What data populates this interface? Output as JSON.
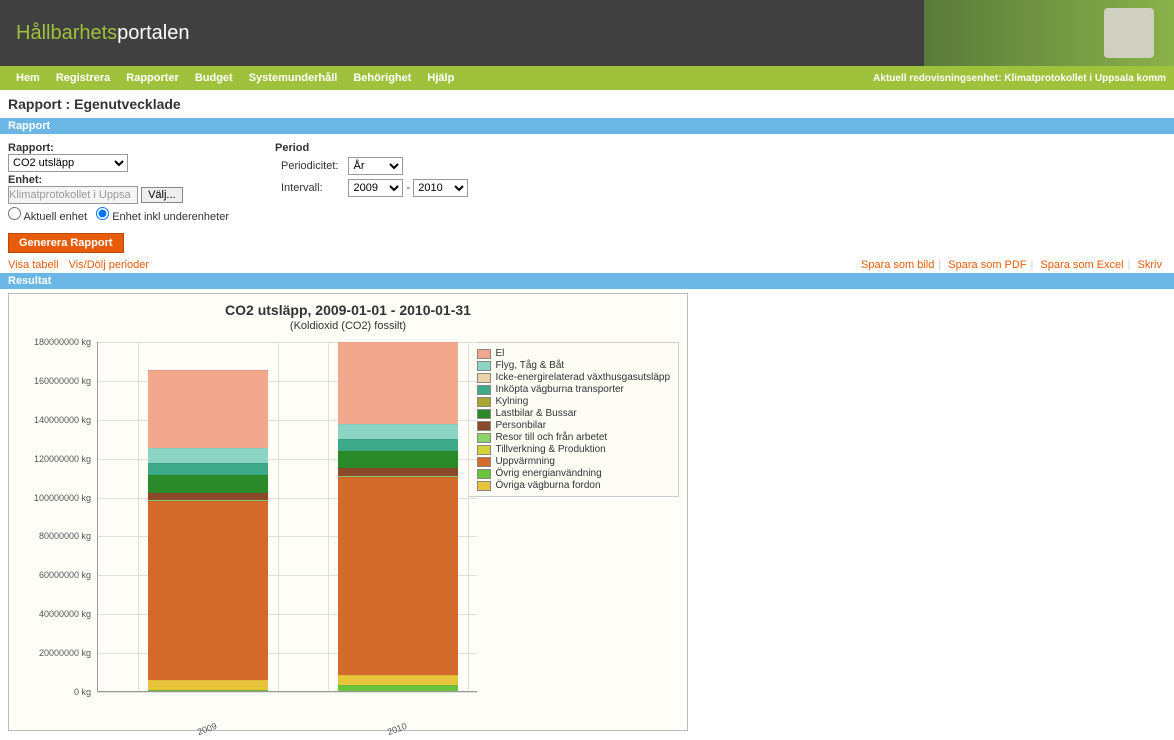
{
  "logo": {
    "part1": "Hållbarhets",
    "part2": "portalen"
  },
  "nav": {
    "items": [
      "Hem",
      "Registrera",
      "Rapporter",
      "Budget",
      "Systemunderhåll",
      "Behörighet",
      "Hjälp"
    ],
    "status": "Aktuell redovisningsenhet: Klimatprotokollet i Uppsala komm"
  },
  "page_title": "Rapport : Egenutvecklade",
  "section1": "Rapport",
  "form": {
    "rapport_label": "Rapport:",
    "rapport_value": "CO2 utsläpp",
    "enhet_label": "Enhet:",
    "enhet_value": "Klimatprotokollet i Uppsa",
    "valj": "Välj...",
    "radio_aktuell": "Aktuell enhet",
    "radio_inkl": "Enhet inkl underenheter",
    "period_label": "Period",
    "periodicitet_label": "Periodicitet:",
    "periodicitet_value": "År",
    "intervall_label": "Intervall:",
    "intervall_from": "2009",
    "intervall_to": "2010",
    "generate": "Generera Rapport"
  },
  "links": {
    "visa": "Visa tabell",
    "visdolj": "Vis/Dölj perioder",
    "bild": "Spara som bild",
    "pdf": "Spara som PDF",
    "excel": "Spara som Excel",
    "skriv": "Skriv"
  },
  "section2": "Resultat",
  "chart_data": {
    "type": "bar",
    "title": "CO2 utsläpp, 2009-01-01 - 2010-01-31",
    "subtitle": "(Koldioxid (CO2) fossilt)",
    "ylabel_unit": "kg",
    "ylim": [
      0,
      180000000
    ],
    "yticks": [
      0,
      20000000,
      40000000,
      60000000,
      80000000,
      100000000,
      120000000,
      140000000,
      160000000,
      180000000
    ],
    "categories": [
      "2009",
      "2010"
    ],
    "series": [
      {
        "name": "El",
        "color": "#f2a88c",
        "values": [
          40000000,
          42000000
        ]
      },
      {
        "name": "Flyg, Tåg & Båt",
        "color": "#8cd4c4",
        "values": [
          8000000,
          8000000
        ]
      },
      {
        "name": "Icke-energirelaterad växthusgasutsläpp",
        "color": "#e8d4a8",
        "values": [
          0,
          0
        ]
      },
      {
        "name": "Inköpta vägburna transporter",
        "color": "#3caa88",
        "values": [
          6000000,
          6000000
        ]
      },
      {
        "name": "Kylning",
        "color": "#a8a830",
        "values": [
          0,
          0
        ]
      },
      {
        "name": "Lastbilar & Bussar",
        "color": "#2a8a2a",
        "values": [
          9000000,
          9000000
        ]
      },
      {
        "name": "Personbilar",
        "color": "#8a4a2a",
        "values": [
          4000000,
          4000000
        ]
      },
      {
        "name": "Resor till och från arbetet",
        "color": "#8cd46a",
        "values": [
          500000,
          500000
        ]
      },
      {
        "name": "Tillverkning & Produktion",
        "color": "#d4d43a",
        "values": [
          0,
          0
        ]
      },
      {
        "name": "Uppvärmning",
        "color": "#d46a2a",
        "values": [
          92000000,
          102000000
        ]
      },
      {
        "name": "Övrig energianvändning",
        "color": "#6ac43a",
        "values": [
          500000,
          3000000
        ]
      },
      {
        "name": "Övriga vägburna fordon",
        "color": "#e8c43a",
        "values": [
          5000000,
          5000000
        ]
      }
    ]
  }
}
